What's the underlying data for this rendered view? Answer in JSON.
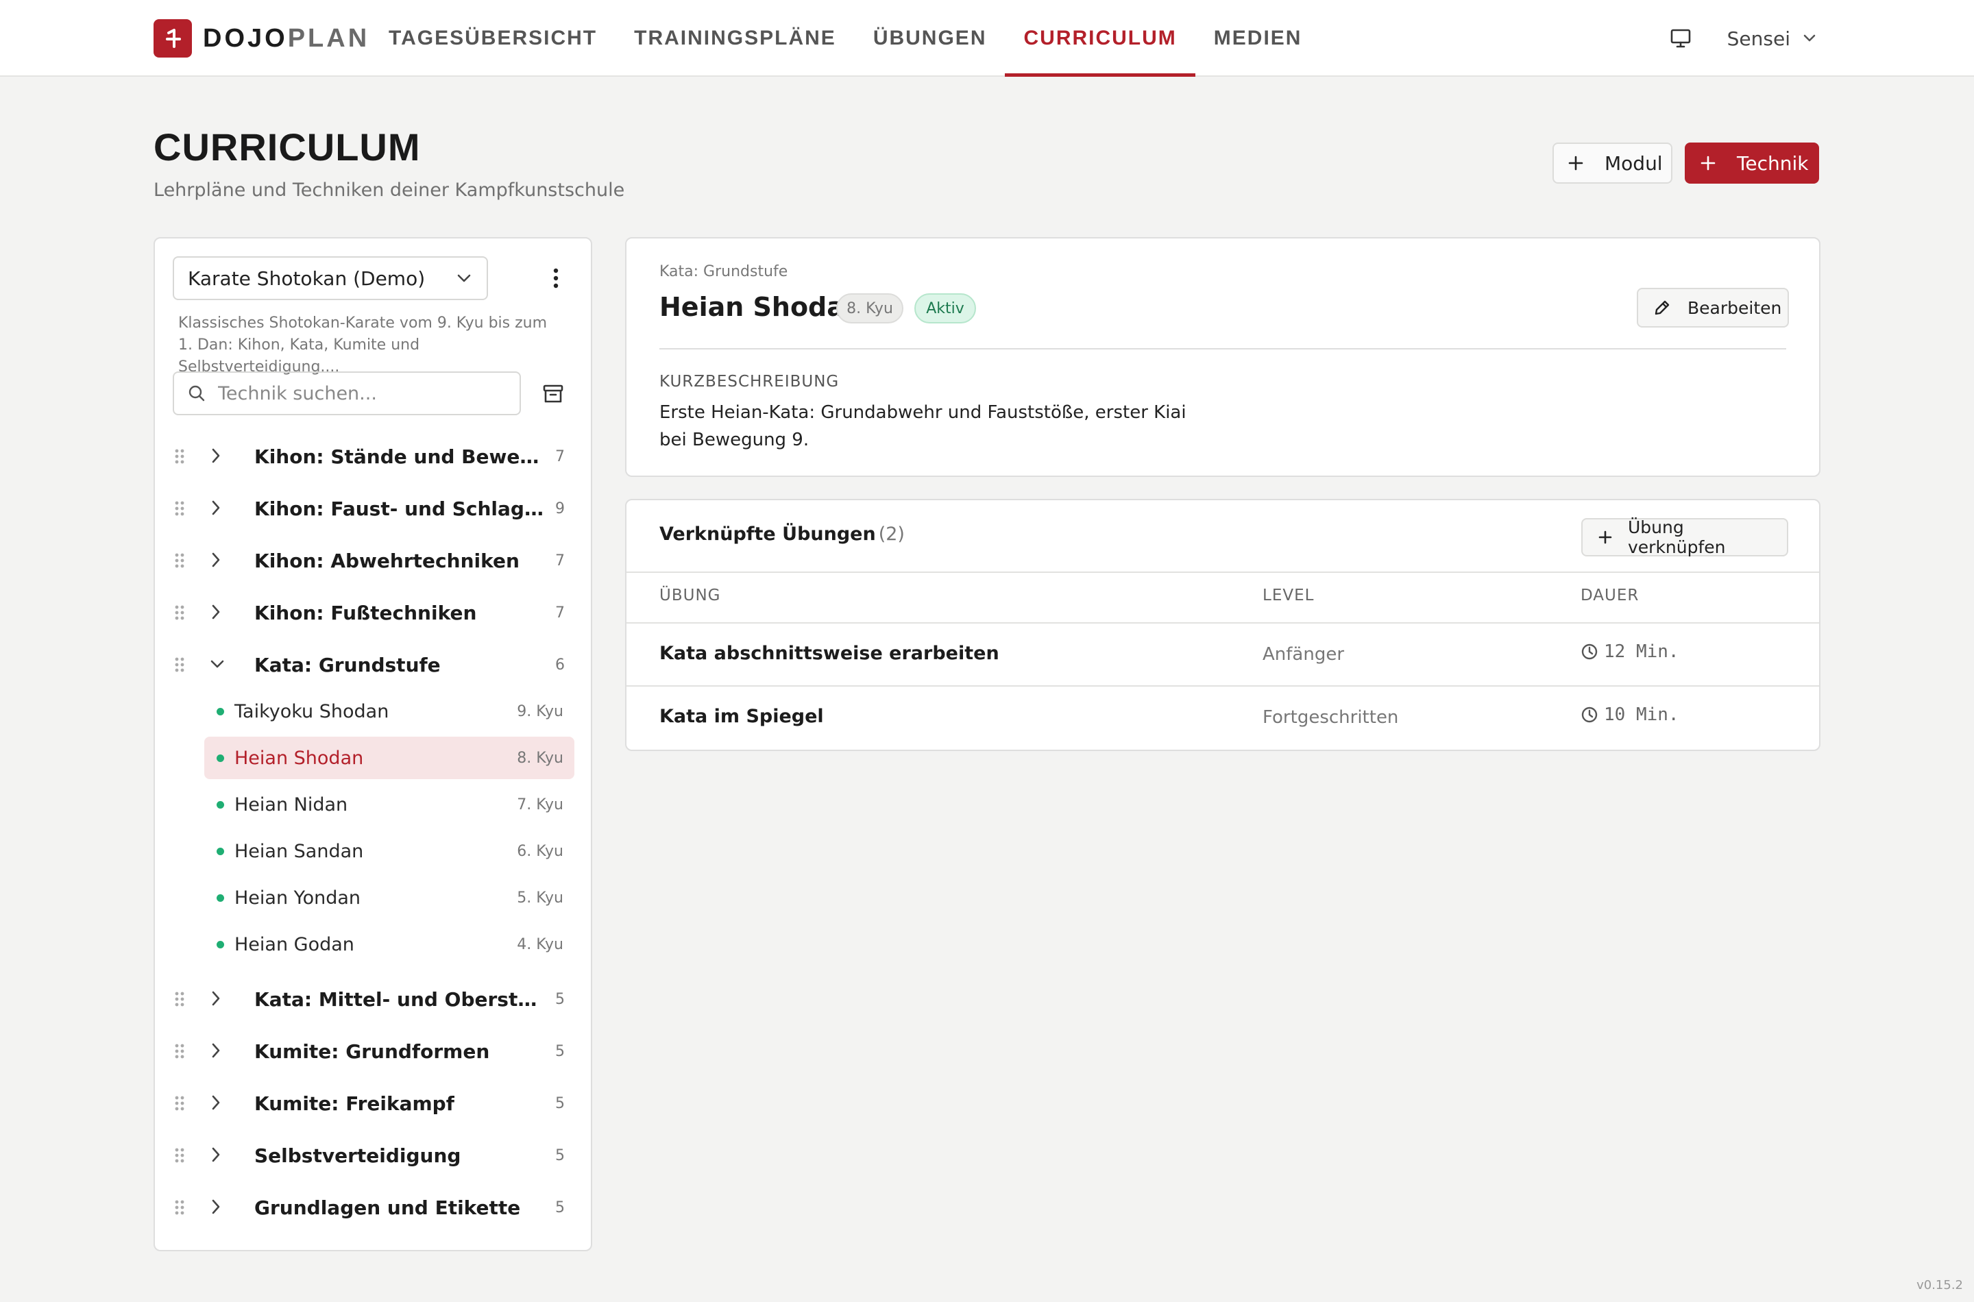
{
  "app": {
    "logo_left": "DOJO",
    "logo_right": "PLAN",
    "version": "v0.15.2"
  },
  "nav": {
    "items": [
      {
        "label": "TAGESÜBERSICHT"
      },
      {
        "label": "TRAININGSPLÄNE"
      },
      {
        "label": "ÜBUNGEN"
      },
      {
        "label": "CURRICULUM"
      },
      {
        "label": "MEDIEN"
      }
    ],
    "active": "CURRICULUM"
  },
  "user": {
    "name": "Sensei"
  },
  "page": {
    "title": "CURRICULUM",
    "subtitle": "Lehrpläne und Techniken deiner Kampfkunstschule",
    "add_module_label": "Modul",
    "add_technique_label": "Technik"
  },
  "sidebar": {
    "curriculum_selected": "Karate Shotokan (Demo)",
    "curriculum_description": "Klassisches Shotokan-Karate vom 9. Kyu bis zum 1. Dan: Kihon, Kata, Kumite und Selbstverteidigung....",
    "search_placeholder": "Technik suchen...",
    "modules": [
      {
        "label": "Kihon: Stände und Bewegung",
        "count": "7",
        "expanded": false
      },
      {
        "label": "Kihon: Faust- und Schlagtechniken",
        "count": "9",
        "expanded": false
      },
      {
        "label": "Kihon: Abwehrtechniken",
        "count": "7",
        "expanded": false
      },
      {
        "label": "Kihon: Fußtechniken",
        "count": "7",
        "expanded": false
      },
      {
        "label": "Kata: Grundstufe",
        "count": "6",
        "expanded": true,
        "techniques": [
          {
            "label": "Taikyoku Shodan",
            "grade": "9. Kyu"
          },
          {
            "label": "Heian Shodan",
            "grade": "8. Kyu",
            "selected": true
          },
          {
            "label": "Heian Nidan",
            "grade": "7. Kyu"
          },
          {
            "label": "Heian Sandan",
            "grade": "6. Kyu"
          },
          {
            "label": "Heian Yondan",
            "grade": "5. Kyu"
          },
          {
            "label": "Heian Godan",
            "grade": "4. Kyu"
          }
        ]
      },
      {
        "label": "Kata: Mittel- und Oberstufe",
        "count": "5",
        "expanded": false
      },
      {
        "label": "Kumite: Grundformen",
        "count": "5",
        "expanded": false
      },
      {
        "label": "Kumite: Freikampf",
        "count": "5",
        "expanded": false
      },
      {
        "label": "Selbstverteidigung",
        "count": "5",
        "expanded": false
      },
      {
        "label": "Grundlagen und Etikette",
        "count": "5",
        "expanded": false
      }
    ]
  },
  "detail": {
    "breadcrumb": "Kata: Grundstufe",
    "title": "Heian Shodan",
    "grade_badge": "8. Kyu",
    "status_badge": "Aktiv",
    "edit_label": "Bearbeiten",
    "section_heading": "KURZBESCHREIBUNG",
    "section_text": "Erste Heian-Kata: Grundabwehr und Fauststöße, erster Kiai bei Bewegung 9."
  },
  "linked": {
    "title": "Verknüpfte Übungen",
    "count": "(2)",
    "link_button_label": "Übung verknüpfen",
    "columns": [
      "ÜBUNG",
      "LEVEL",
      "DAUER"
    ],
    "rows": [
      {
        "name": "Kata abschnittsweise erarbeiten",
        "level": "Anfänger",
        "duration": "12 Min."
      },
      {
        "name": "Kata im Spiegel",
        "level": "Fortgeschritten",
        "duration": "10 Min."
      }
    ]
  },
  "colors": {
    "brand": "#b3202a",
    "active_dot": "#1fae73",
    "selected_bg": "#f7e4e5"
  }
}
